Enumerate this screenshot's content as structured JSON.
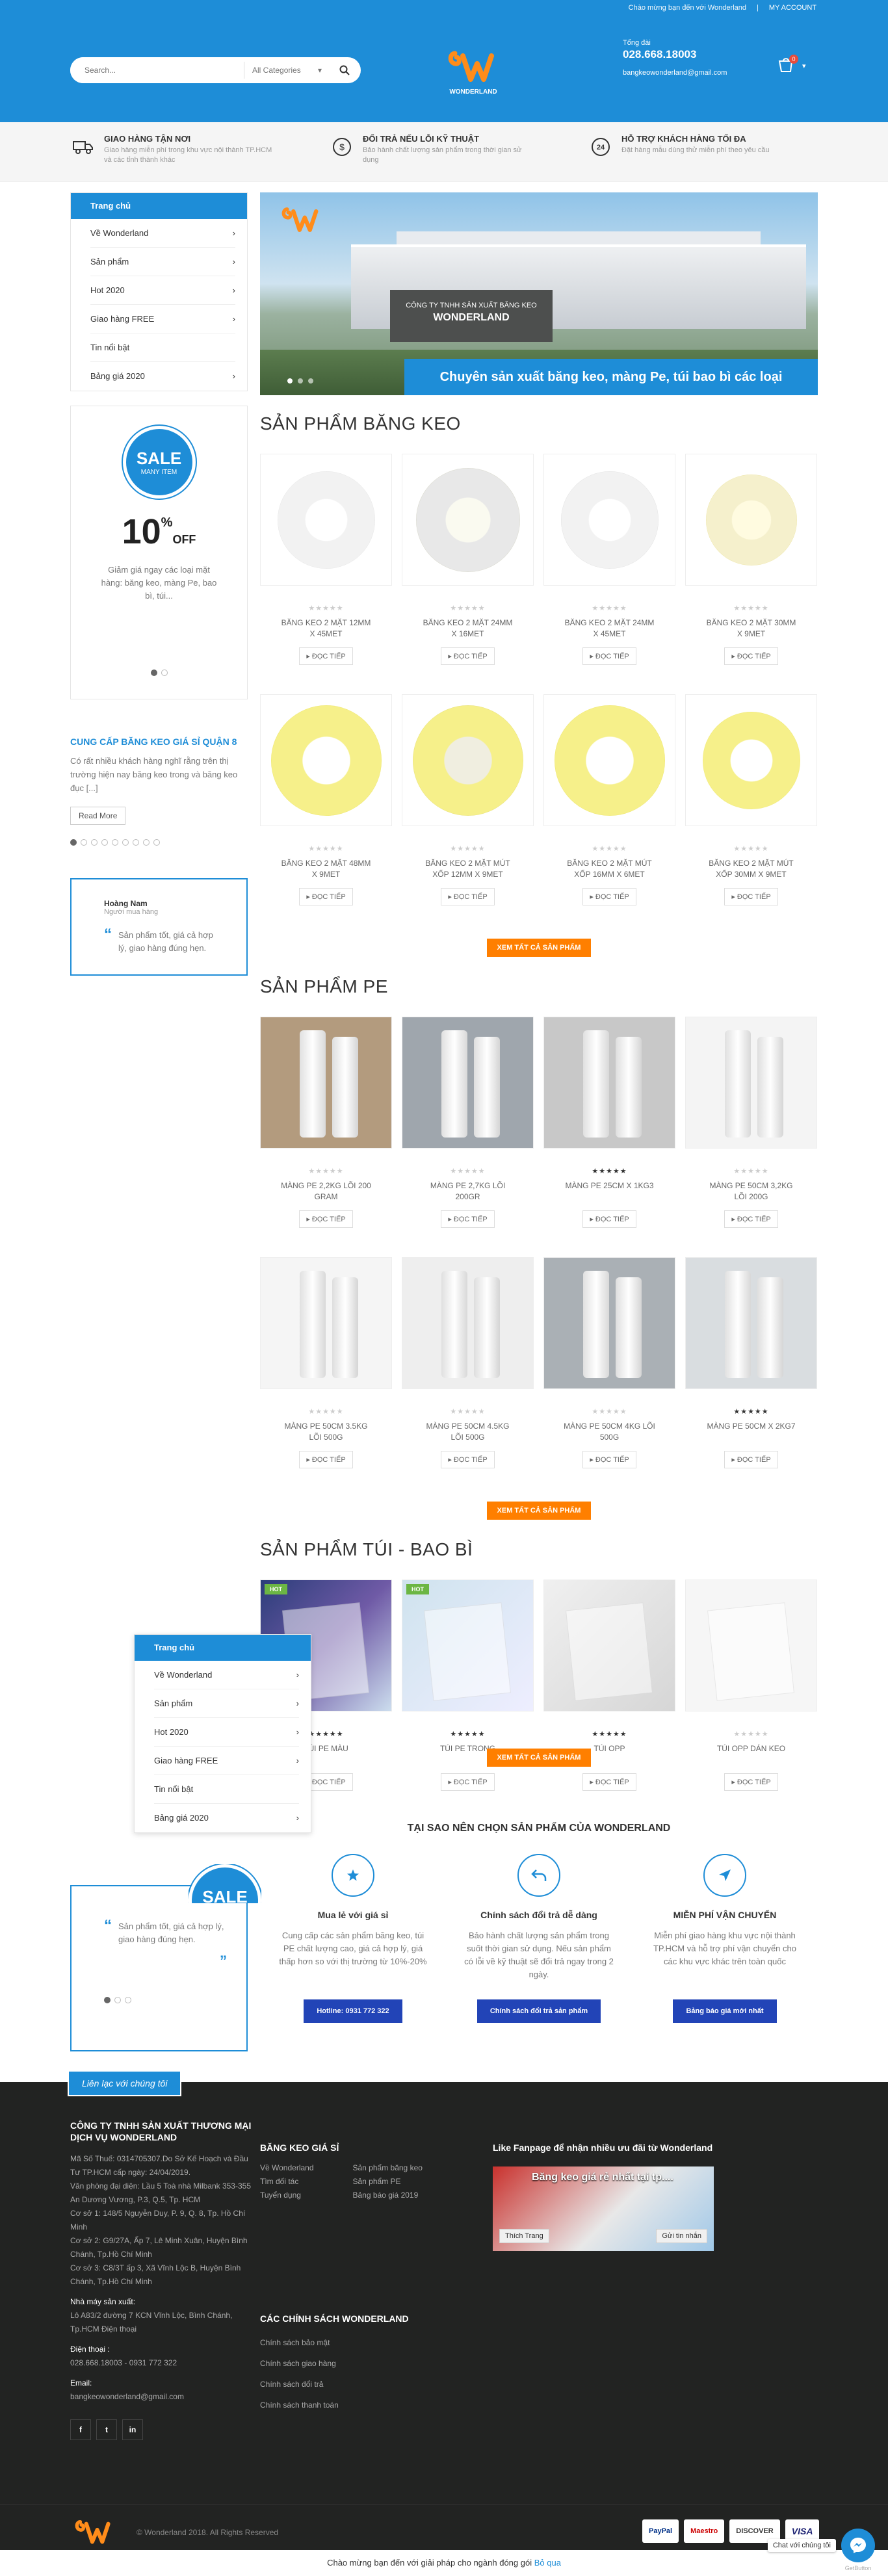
{
  "colors": {
    "primary": "#1e8dd7",
    "accent": "#ff7f00",
    "footer": "#222322",
    "why_button": "#2244b7"
  },
  "topbar": {
    "welcome": "Chào mừng bạn đến với Wonderland",
    "account": "MY ACCOUNT"
  },
  "search": {
    "placeholder": "Search...",
    "category": "All Categories"
  },
  "logo": {
    "text": "WONDERLAND"
  },
  "contact": {
    "label": "Tổng đài",
    "phone": "028.668.18003",
    "email": "bangkeowonderland@gmail.com"
  },
  "cart": {
    "count": "0"
  },
  "features": [
    {
      "icon": "truck-icon",
      "title": "GIAO HÀNG TẬN NƠI",
      "text": "Giao hàng miễn phí trong khu vực nội thành TP.HCM và các tỉnh thành khác"
    },
    {
      "icon": "dollar-icon",
      "title": "ĐỔI TRẢ NẾU LỖI KỸ THUẬT",
      "text": "Bảo hành chất lượng sản phẩm trong thời gian sử dụng"
    },
    {
      "icon": "24-icon",
      "title": "HỖ TRỢ KHÁCH HÀNG TỐI ĐA",
      "text": "Đặt hàng mẫu dùng thử miễn phí theo yêu cầu"
    }
  ],
  "menu": {
    "head": "Trang chủ",
    "items": [
      "Về Wonderland",
      "Sản phẩm",
      "Hot 2020",
      "Giao hàng FREE",
      "Tin nổi bật",
      "Bảng giá 2020"
    ]
  },
  "sale": {
    "badge": "SALE",
    "badge_sub": "MANY ITEM",
    "percent": "10",
    "off": "OFF",
    "text": "Giảm giá ngay các loại mặt hàng: băng keo, màng Pe, bao bì, túi..."
  },
  "post": {
    "title": "CUNG CẤP BĂNG KEO GIÁ SỈ QUẬN 8",
    "excerpt": "Có rất nhiều khách hàng nghĩ rằng trên thị trường hiện nay băng keo trong và băng keo đục [...]",
    "more": "Read More"
  },
  "review": {
    "name": "Hoàng Nam",
    "role": "Người mua hàng",
    "text": "Sản phẩm tốt, giá cả hợp lý, giao hàng đúng hẹn."
  },
  "banner": {
    "sign_top": "CÔNG TY TNHH SẢN XUẤT BĂNG KEO",
    "sign_name": "WONDERLAND",
    "caption": "Chuyên sản xuất băng keo, màng Pe, túi bao bì các loại"
  },
  "detail_label": "ĐỌC TIẾP",
  "viewall_label": "XEM TẤT CẢ SẢN PHẨM",
  "sections": {
    "tape": {
      "title": "SẢN PHẨM BĂNG KEO",
      "products": [
        {
          "name": "BĂNG KEO 2 MẶT 12MM X 45MET"
        },
        {
          "name": "BĂNG KEO 2 MẶT 24MM X 16MET"
        },
        {
          "name": "BĂNG KEO 2 MẶT 24MM X 45MET"
        },
        {
          "name": "BĂNG KEO 2 MẶT 30MM x 9MET"
        },
        {
          "name": "BĂNG KEO 2 MẶT 48MM X 9MET"
        },
        {
          "name": "BĂNG KEO 2 MẶT MÚT XỐP 12MM X 9MET"
        },
        {
          "name": "BĂNG KEO 2 MẶT MÚT XỐP 16MM X 6MET"
        },
        {
          "name": "BĂNG KEO 2 MẶT MÚT XỐP 30MM X 9MET"
        }
      ]
    },
    "pe": {
      "title": "SẢN PHẨM PE",
      "products": [
        {
          "name": "MÀNG PE 2,2KG LÕI 200 GRAM"
        },
        {
          "name": "MÀNG PE 2,7KG LÕI 200GR"
        },
        {
          "name": "MÀNG PE 25CM X 1KG3"
        },
        {
          "name": "MÀNG PE 50CM 3,2KG LÕI 200G"
        },
        {
          "name": "MÀNG PE 50CM 3.5KG LÕI 500G"
        },
        {
          "name": "MÀNG PE 50CM 4.5KG LÕI 500G"
        },
        {
          "name": "MÀNG PE 50CM 4KG LÕI 500G"
        },
        {
          "name": "MÀNG PE 50CM X 2KG7"
        }
      ]
    },
    "bags": {
      "title": "SẢN PHẨM TÚI - BAO BÌ",
      "hot_label": "HOT",
      "products": [
        {
          "name": "Túi PE màu"
        },
        {
          "name": "Túi PE trong"
        },
        {
          "name": "Túi OPP"
        },
        {
          "name": "Túi OPP dán keo"
        }
      ]
    }
  },
  "why": {
    "title": "TẠI SAO NÊN CHỌN SẢN PHẨM CỦA WONDERLAND",
    "cols": [
      {
        "icon": "star-icon",
        "title": "Mua lẻ với giá sỉ",
        "text": "Cung cấp các sản phẩm băng keo, túi PE chất lượng cao, giá cả hợp lý, giá thấp hơn so với thị trường từ 10%-20%",
        "button": "Hotline: 0931 772 322"
      },
      {
        "icon": "return-icon",
        "title": "Chính sách đổi trả dễ dàng",
        "text": "Bảo hành chất lượng sản phẩm trong suốt thời gian sử dụng. Nếu sản phẩm có lỗi về kỹ thuật sẽ đổi trả ngay trong 2 ngày.",
        "button": "Chính sách đổi trả sản phẩm"
      },
      {
        "icon": "send-icon",
        "title": "MIỄN PHÍ VẬN CHUYỂN",
        "text": "Miễn phí giao hàng khu vực nội thành TP.HCM và hỗ trợ phí vận chuyển cho các khu vực khác trên toàn quốc",
        "button": "Bảng báo giá mới nhất"
      }
    ]
  },
  "footer": {
    "contact_tab": "Liên lạc với chúng tôi",
    "company": "CÔNG TY TNHH SẢN XUẤT THƯƠNG MẠI DỊCH VỤ WONDERLAND",
    "lines": [
      "Mã Số Thuế: 0314705307.Do Sở Kế Hoạch và Đầu Tư TP.HCM cấp ngày: 24/04/2019.",
      "Văn phòng đại diện: Lầu 5 Toà nhà Milbank 353-355 An Dương Vương, P.3, Q.5, Tp. HCM",
      "Cơ sở 1: 148/5 Nguyễn Duy, P. 9, Q. 8, Tp. Hồ Chí Minh",
      "Cơ sở 2: G9/27A, Ấp 7, Lê Minh Xuân, Huyện Bình Chánh, Tp.Hồ Chí Minh",
      "Cơ sở 3: C8/3T ấp 3, Xã Vĩnh Lộc B, Huyện Bình Chánh, Tp.Hồ Chí Minh"
    ],
    "factory_label": "Nhà máy sản xuất:",
    "factory": "Lô A83/2 đường 7 KCN Vĩnh Lộc, Bình Chánh, Tp.HCM Điện thoại",
    "phone_label": "Điện thoại :",
    "phones": "028.668.18003 - 0931 772 322",
    "email_label": "Email:",
    "email": "bangkeowonderland@gmail.com",
    "social": [
      "f",
      "t",
      "in"
    ],
    "col2_title": "BĂNG KEO GIÁ SỈ",
    "col2_links_a": [
      "Về Wonderland",
      "Tìm đối tác",
      "Tuyển dụng"
    ],
    "col2_links_b": [
      "Sản phẩm băng keo",
      "Sản phẩm PE",
      "Bảng báo giá 2019"
    ],
    "col3_title": "CÁC CHÍNH SÁCH WONDERLAND",
    "col3_links": [
      "Chính sách bảo mật",
      "Chính sách giao hàng",
      "Chính sách đổi trả",
      "Chính sách thanh toán"
    ],
    "fb_title": "Like Fanpage để nhận nhiều ưu đãi từ Wonderland",
    "fb_page": "Băng keo giá rẻ nhất tại tp....",
    "fb_like": "Thích Trang",
    "fb_msg": "Gửi tin nhắn",
    "copyright": "© Wonderland 2018. All Rights Reserved",
    "payments": [
      "PayPal",
      "Maestro",
      "DISCOVER",
      "VISA"
    ],
    "bottom_text": "Chào mừng bạn đến với giải pháp cho ngành đóng gói ",
    "bottom_link": "Bỏ qua",
    "chat_tip": "Chat với chúng tôi",
    "getbutton": "GetButton"
  }
}
